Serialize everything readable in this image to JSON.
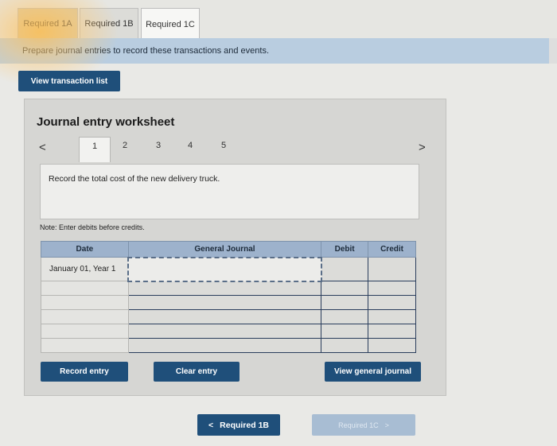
{
  "tabs": [
    {
      "label": "Required 1A"
    },
    {
      "label": "Required 1B"
    },
    {
      "label": "Required 1C"
    }
  ],
  "instruction": "Prepare journal entries to record these transactions and events.",
  "view_transaction_list_label": "View transaction list",
  "worksheet": {
    "title": "Journal entry worksheet",
    "nav_prev": "<",
    "nav_next": ">",
    "steps": [
      "1",
      "2",
      "3",
      "4",
      "5"
    ],
    "current_step": "1",
    "prompt": "Record the total cost of the new delivery truck.",
    "note": "Note: Enter debits before credits.",
    "columns": {
      "date": "Date",
      "general_journal": "General Journal",
      "debit": "Debit",
      "credit": "Credit"
    },
    "rows": [
      {
        "date": "January 01, Year 1",
        "account": "",
        "debit": "",
        "credit": ""
      },
      {
        "date": "",
        "account": "",
        "debit": "",
        "credit": ""
      },
      {
        "date": "",
        "account": "",
        "debit": "",
        "credit": ""
      },
      {
        "date": "",
        "account": "",
        "debit": "",
        "credit": ""
      },
      {
        "date": "",
        "account": "",
        "debit": "",
        "credit": ""
      },
      {
        "date": "",
        "account": "",
        "debit": "",
        "credit": ""
      }
    ],
    "record_entry_label": "Record entry",
    "clear_entry_label": "Clear entry",
    "view_general_journal_label": "View general journal"
  },
  "bottom_nav": {
    "prev_label": "Required 1B",
    "prev_icon": "<",
    "next_label": "Required 1C",
    "next_icon": ">"
  },
  "colors": {
    "primary_button": "#1f4f7a",
    "instruction_bar": "#b9cde0",
    "table_header": "#9db2cc",
    "disabled_button": "#a8bdd3"
  }
}
